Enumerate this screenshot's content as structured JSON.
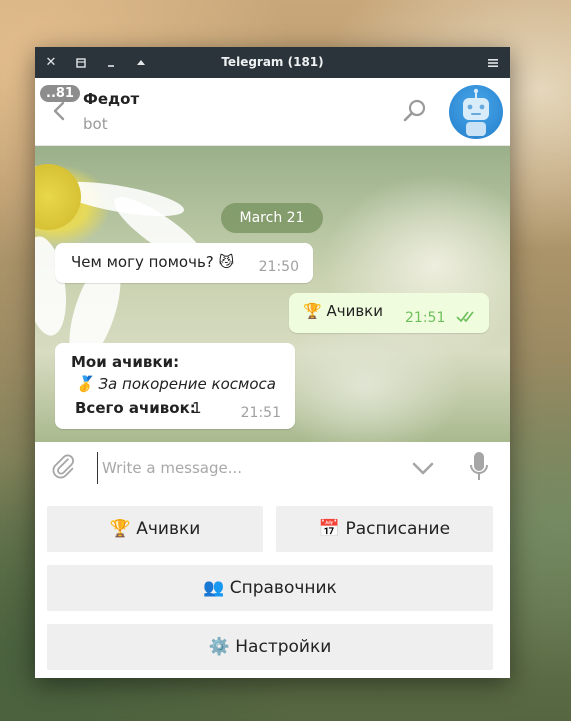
{
  "window": {
    "title": "Telegram (181)",
    "controls": {
      "close": "✕",
      "maximize": "⧉",
      "minimize": "–",
      "up": "▲",
      "menu": "≡"
    }
  },
  "header": {
    "unread_badge": "..81",
    "peer_name": "Федот",
    "peer_status": "bot"
  },
  "messages": {
    "date": "March 21",
    "m1": {
      "text": "Чем могу помочь? 😼",
      "time": "21:50"
    },
    "m2": {
      "text": "🏆 Ачивки",
      "time": "21:51"
    },
    "m3": {
      "title": "Мои ачивки:",
      "item": "🥇 За покорение космоса",
      "total_label": "Всего ачивок:",
      "total_value": "1",
      "time": "21:51"
    }
  },
  "composer": {
    "placeholder": "Write a message..."
  },
  "keyboard": {
    "achievements": "🏆 Ачивки",
    "schedule": "📅 Расписание",
    "reference": "👥 Справочник",
    "settings": "⚙️ Настройки"
  },
  "colors": {
    "titlebar": "#2b343a",
    "out_bubble": "#effdde",
    "out_check": "#6fbf5d",
    "date_pill": "#7d9664",
    "avatar": "#2f8ad4",
    "keyboard_button": "#efefef"
  },
  "icons": {
    "back": "back-arrow-icon",
    "search": "search-icon",
    "attach": "paperclip-icon",
    "chevron": "chevron-down-icon",
    "mic": "microphone-icon",
    "read": "double-check-icon"
  }
}
